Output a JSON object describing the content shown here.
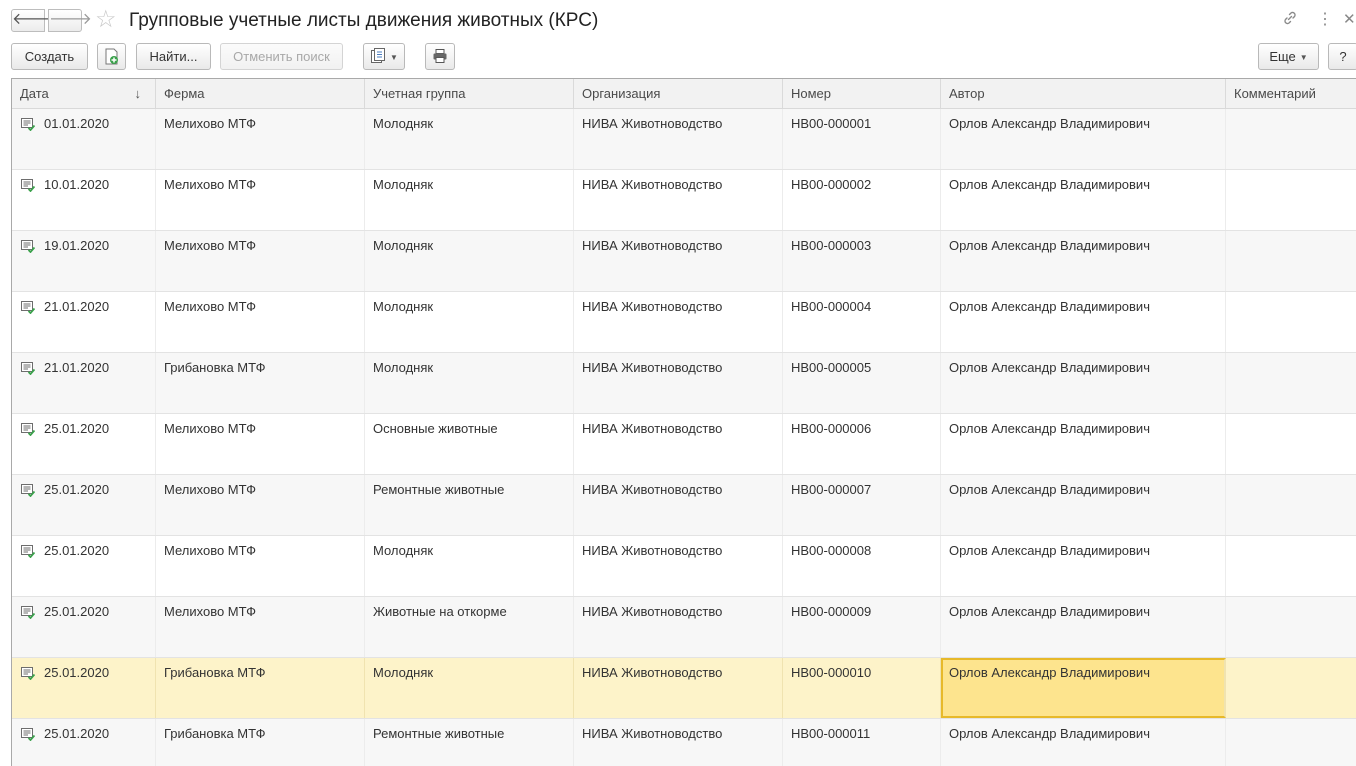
{
  "window": {
    "title": "Групповые учетные листы движения животных (КРС)"
  },
  "icons": {
    "back": "arrow-left-icon",
    "forward": "arrow-right-icon",
    "favorite": "star-icon",
    "link": "link-icon",
    "menu": "more-vertical-icon",
    "close": "close-icon",
    "create_copy": "create-by-copy-icon",
    "reports": "reports-icon",
    "print": "print-icon",
    "row_document": "document-posted-icon"
  },
  "toolbar": {
    "create_label": "Создать",
    "find_label": "Найти...",
    "cancel_search_label": "Отменить поиск",
    "more_label": "Еще",
    "help_label": "?"
  },
  "table": {
    "columns": [
      "Дата",
      "Ферма",
      "Учетная группа",
      "Организация",
      "Номер",
      "Автор",
      "Комментарий"
    ],
    "rows": [
      {
        "date": "01.01.2020",
        "farm": "Мелихово МТФ",
        "group": "Молодняк",
        "org": "НИВА Животноводство",
        "number": "НВ00-000001",
        "author": "Орлов Александр Владимирович",
        "comment": ""
      },
      {
        "date": "10.01.2020",
        "farm": "Мелихово МТФ",
        "group": "Молодняк",
        "org": "НИВА Животноводство",
        "number": "НВ00-000002",
        "author": "Орлов Александр Владимирович",
        "comment": ""
      },
      {
        "date": "19.01.2020",
        "farm": "Мелихово МТФ",
        "group": "Молодняк",
        "org": "НИВА Животноводство",
        "number": "НВ00-000003",
        "author": "Орлов Александр Владимирович",
        "comment": ""
      },
      {
        "date": "21.01.2020",
        "farm": "Мелихово МТФ",
        "group": "Молодняк",
        "org": "НИВА Животноводство",
        "number": "НВ00-000004",
        "author": "Орлов Александр Владимирович",
        "comment": ""
      },
      {
        "date": "21.01.2020",
        "farm": "Грибановка МТФ",
        "group": "Молодняк",
        "org": "НИВА Животноводство",
        "number": "НВ00-000005",
        "author": "Орлов Александр Владимирович",
        "comment": ""
      },
      {
        "date": "25.01.2020",
        "farm": "Мелихово МТФ",
        "group": "Основные животные",
        "org": "НИВА Животноводство",
        "number": "НВ00-000006",
        "author": "Орлов Александр Владимирович",
        "comment": ""
      },
      {
        "date": "25.01.2020",
        "farm": "Мелихово МТФ",
        "group": "Ремонтные животные",
        "org": "НИВА Животноводство",
        "number": "НВ00-000007",
        "author": "Орлов Александр Владимирович",
        "comment": ""
      },
      {
        "date": "25.01.2020",
        "farm": "Мелихово МТФ",
        "group": "Молодняк",
        "org": "НИВА Животноводство",
        "number": "НВ00-000008",
        "author": "Орлов Александр Владимирович",
        "comment": ""
      },
      {
        "date": "25.01.2020",
        "farm": "Мелихово МТФ",
        "group": "Животные на откорме",
        "org": "НИВА Животноводство",
        "number": "НВ00-000009",
        "author": "Орлов Александр Владимирович",
        "comment": ""
      },
      {
        "date": "25.01.2020",
        "farm": "Грибановка МТФ",
        "group": "Молодняк",
        "org": "НИВА Животноводство",
        "number": "НВ00-000010",
        "author": "Орлов Александр Владимирович",
        "comment": ""
      },
      {
        "date": "25.01.2020",
        "farm": "Грибановка МТФ",
        "group": "Ремонтные животные",
        "org": "НИВА Животноводство",
        "number": "НВ00-000011",
        "author": "Орлов Александр Владимирович",
        "comment": ""
      }
    ],
    "selected_row": 9,
    "focused_column": "author",
    "sort_column": "Дата",
    "sort_direction": "descending"
  },
  "colors": {
    "selected_row": "#fdf3c9",
    "focused_cell": "#fde48e",
    "focused_border": "#e7b92a",
    "posted_icon_green": "#3aa14b"
  }
}
